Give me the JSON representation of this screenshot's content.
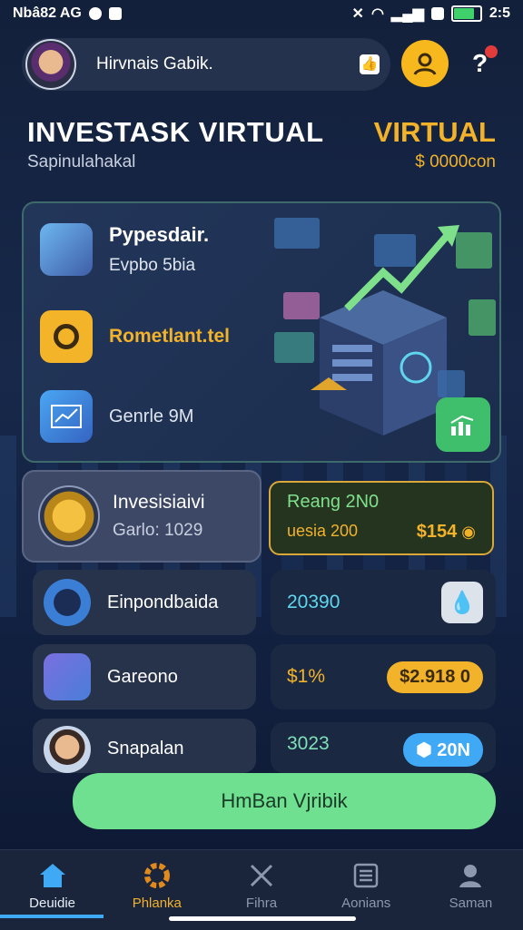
{
  "status_bar": {
    "left_text": "Nbâ82 AG",
    "time": "2:5"
  },
  "header": {
    "user_name": "Hirvnais Gabik."
  },
  "hero": {
    "title": "INVESTASK VIRTUAL",
    "subtitle": "Sapinulahakal",
    "virtual_label": "VIRTUAL",
    "virtual_value": "$ 0000con"
  },
  "features": [
    {
      "title": "Pypesdair.",
      "subtitle": "Evpbo 5bia"
    },
    {
      "title": "Rometlant.tel"
    },
    {
      "title": "Genrle 9M"
    }
  ],
  "investment": {
    "title": "Invesisiaivi",
    "subtitle": "Garlo: 1029",
    "reading_title": "Reang 2N0",
    "reading_sub": "uesia 200",
    "reading_amount": "$154"
  },
  "rows": [
    {
      "label": "Einpondbaida",
      "value": "20390"
    },
    {
      "label": "Gareono",
      "value": "$1%",
      "badge": "$2.918"
    },
    {
      "label": "Snapalan",
      "value": "3023",
      "badge": "20N"
    }
  ],
  "cta": {
    "label": "HmBan Vjribik"
  },
  "nav": [
    {
      "label": "Deuidie",
      "icon": "home-icon"
    },
    {
      "label": "Phlanka",
      "icon": "gear-icon"
    },
    {
      "label": "Fihra",
      "icon": "tools-icon"
    },
    {
      "label": "Aonians",
      "icon": "list-icon"
    },
    {
      "label": "Saman",
      "icon": "user-icon"
    }
  ],
  "colors": {
    "accent": "#f2b22a",
    "green": "#6ee08f",
    "cyan": "#5fd6ee",
    "nav_active": "#3fa9f5"
  }
}
